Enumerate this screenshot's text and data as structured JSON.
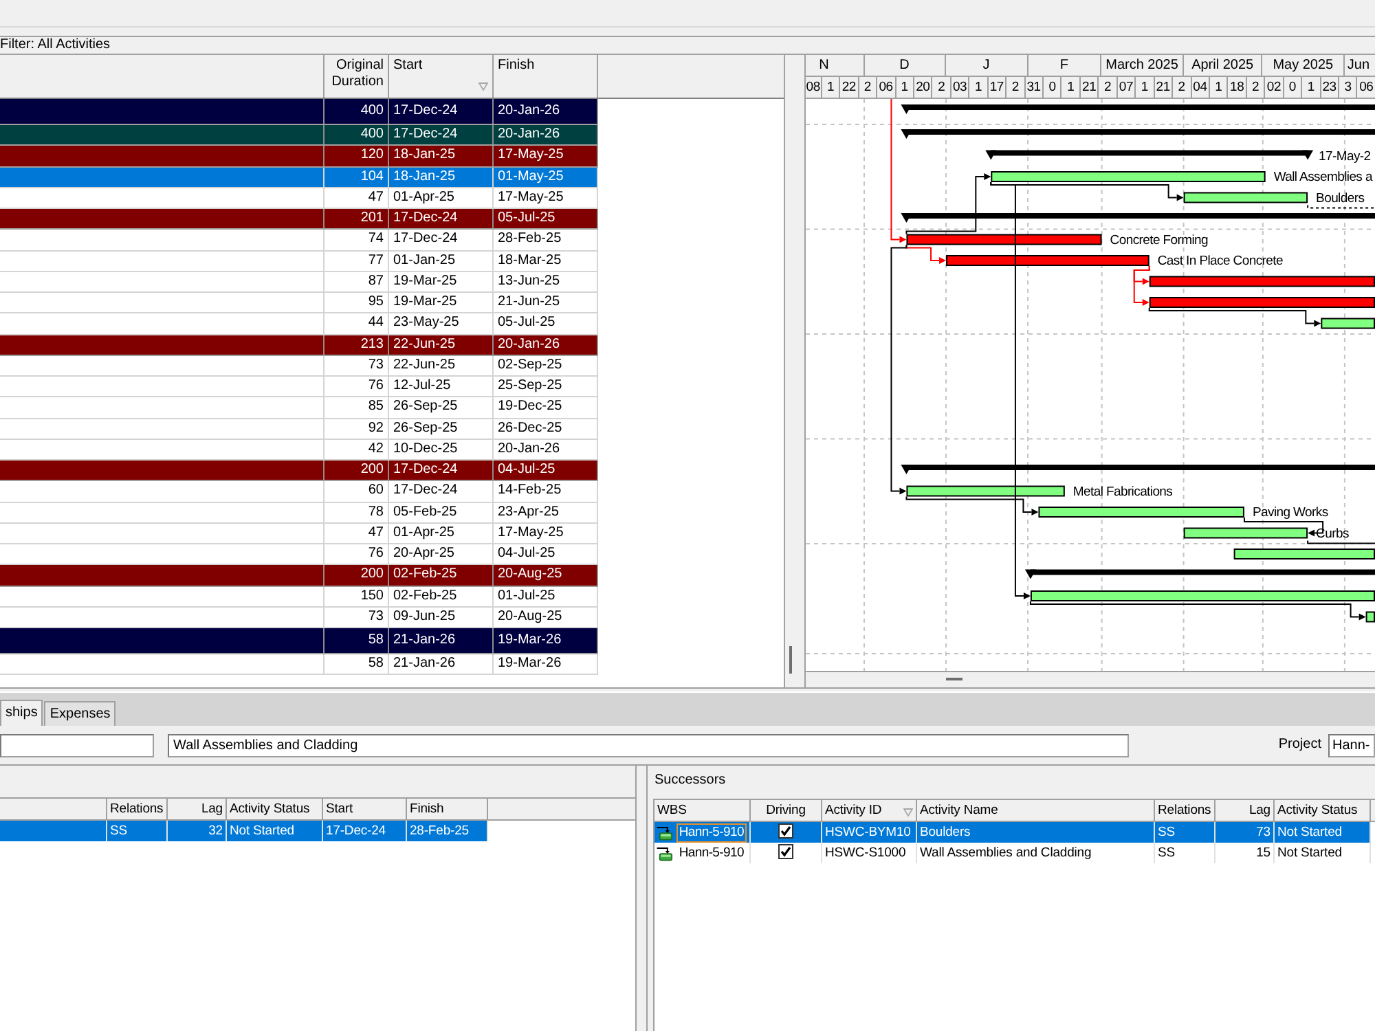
{
  "filter": {
    "label": "Filter: All Activities"
  },
  "table": {
    "columns": [
      {
        "label": "Original Duration",
        "sorted": false
      },
      {
        "label": "Start",
        "sorted": true
      },
      {
        "label": "Finish",
        "sorted": false
      }
    ],
    "rows": [
      {
        "kind": "project",
        "color": "#000040",
        "duration": "400",
        "start": "17-Dec-24",
        "finish": "20-Jan-26",
        "selected": false
      },
      {
        "kind": "wbs",
        "color": "#004040",
        "duration": "400",
        "start": "17-Dec-24",
        "finish": "20-Jan-26",
        "selected": false
      },
      {
        "kind": "wbs",
        "color": "#800000",
        "duration": "120",
        "start": "18-Jan-25",
        "finish": "17-May-25",
        "selected": false,
        "bar_label": "17-May-2"
      },
      {
        "kind": "activity",
        "duration": "104",
        "start": "18-Jan-25",
        "finish": "01-May-25",
        "selected": true,
        "critical": false,
        "bar_label": "Wall Assemblies a"
      },
      {
        "kind": "activity",
        "duration": "47",
        "start": "01-Apr-25",
        "finish": "17-May-25",
        "selected": false,
        "critical": false,
        "bar_label": "Boulders"
      },
      {
        "kind": "wbs",
        "color": "#800000",
        "duration": "201",
        "start": "17-Dec-24",
        "finish": "05-Jul-25",
        "selected": false
      },
      {
        "kind": "activity",
        "duration": "74",
        "start": "17-Dec-24",
        "finish": "28-Feb-25",
        "selected": false,
        "critical": true,
        "bar_label": "Concrete Forming"
      },
      {
        "kind": "activity",
        "duration": "77",
        "start": "01-Jan-25",
        "finish": "18-Mar-25",
        "selected": false,
        "critical": true,
        "bar_label": "Cast In Place Concrete"
      },
      {
        "kind": "activity",
        "duration": "87",
        "start": "19-Mar-25",
        "finish": "13-Jun-25",
        "selected": false,
        "critical": true
      },
      {
        "kind": "activity",
        "duration": "95",
        "start": "19-Mar-25",
        "finish": "21-Jun-25",
        "selected": false,
        "critical": true
      },
      {
        "kind": "activity",
        "duration": "44",
        "start": "23-May-25",
        "finish": "05-Jul-25",
        "selected": false,
        "critical": false
      },
      {
        "kind": "wbs",
        "color": "#800000",
        "duration": "213",
        "start": "22-Jun-25",
        "finish": "20-Jan-26",
        "selected": false
      },
      {
        "kind": "activity",
        "duration": "73",
        "start": "22-Jun-25",
        "finish": "02-Sep-25",
        "selected": false
      },
      {
        "kind": "activity",
        "duration": "76",
        "start": "12-Jul-25",
        "finish": "25-Sep-25",
        "selected": false
      },
      {
        "kind": "activity",
        "duration": "85",
        "start": "26-Sep-25",
        "finish": "19-Dec-25",
        "selected": false
      },
      {
        "kind": "activity",
        "duration": "92",
        "start": "26-Sep-25",
        "finish": "26-Dec-25",
        "selected": false
      },
      {
        "kind": "activity",
        "duration": "42",
        "start": "10-Dec-25",
        "finish": "20-Jan-26",
        "selected": false
      },
      {
        "kind": "wbs",
        "color": "#800000",
        "duration": "200",
        "start": "17-Dec-24",
        "finish": "04-Jul-25",
        "selected": false
      },
      {
        "kind": "activity",
        "duration": "60",
        "start": "17-Dec-24",
        "finish": "14-Feb-25",
        "selected": false,
        "critical": false,
        "bar_label": "Metal Fabrications"
      },
      {
        "kind": "activity",
        "duration": "78",
        "start": "05-Feb-25",
        "finish": "23-Apr-25",
        "selected": false,
        "critical": false,
        "bar_label": "Paving Works"
      },
      {
        "kind": "activity",
        "duration": "47",
        "start": "01-Apr-25",
        "finish": "17-May-25",
        "selected": false,
        "critical": false,
        "bar_label": "Curbs"
      },
      {
        "kind": "activity",
        "duration": "76",
        "start": "20-Apr-25",
        "finish": "04-Jul-25",
        "selected": false,
        "critical": false
      },
      {
        "kind": "wbs",
        "color": "#800000",
        "duration": "200",
        "start": "02-Feb-25",
        "finish": "20-Aug-25",
        "selected": false
      },
      {
        "kind": "activity",
        "duration": "150",
        "start": "02-Feb-25",
        "finish": "01-Jul-25",
        "selected": false,
        "critical": false
      },
      {
        "kind": "activity",
        "duration": "73",
        "start": "09-Jun-25",
        "finish": "20-Aug-25",
        "selected": false,
        "critical": false
      },
      {
        "kind": "project",
        "color": "#000040",
        "duration": "58",
        "start": "21-Jan-26",
        "finish": "19-Mar-26",
        "selected": false
      },
      {
        "kind": "activity",
        "duration": "58",
        "start": "21-Jan-26",
        "finish": "19-Mar-26",
        "selected": false
      }
    ]
  },
  "gantt": {
    "months": [
      "N",
      "D",
      "J",
      "F",
      "March 2025",
      "April 2025",
      "May 2025",
      "Jun"
    ],
    "weeks": [
      "08",
      "1",
      "22",
      "2",
      "06",
      "1",
      "20",
      "2",
      "03",
      "1",
      "17",
      "2",
      "31",
      "0",
      "1",
      "21",
      "2",
      "07",
      "1",
      "21",
      "2",
      "04",
      "1",
      "18",
      "2",
      "02",
      "0",
      "1",
      "23",
      "3",
      "06"
    ]
  },
  "details": {
    "tabs": [
      {
        "label": "ships",
        "selected": true
      },
      {
        "label": "Expenses",
        "selected": false
      }
    ],
    "name_field": {
      "value": "Wall Assemblies and Cladding"
    },
    "project_field": {
      "label": "Project",
      "value": "Hann-"
    }
  },
  "predecessors": {
    "columns": [
      {
        "label": "Relations"
      },
      {
        "label": "Lag"
      },
      {
        "label": "Activity Status"
      },
      {
        "label": "Start"
      },
      {
        "label": "Finish"
      }
    ],
    "rows": [
      {
        "selected": true,
        "relationship": "SS",
        "lag": "32",
        "status": "Not Started",
        "start": "17-Dec-24",
        "finish": "28-Feb-25"
      }
    ]
  },
  "successors": {
    "title": "Successors",
    "columns": [
      {
        "label": "WBS",
        "sorted": false
      },
      {
        "label": "Driving",
        "sorted": false
      },
      {
        "label": "Activity ID",
        "sorted": true
      },
      {
        "label": "Activity Name",
        "sorted": false
      },
      {
        "label": "Relations",
        "sorted": false
      },
      {
        "label": "Lag",
        "sorted": false
      },
      {
        "label": "Activity Status",
        "sorted": false
      }
    ],
    "rows": [
      {
        "selected": true,
        "focused": true,
        "wbs": "Hann-5-910",
        "driving": true,
        "activity_id": "HSWC-BYM10",
        "activity_name": "Boulders",
        "relationship": "SS",
        "lag": "73",
        "status": "Not Started"
      },
      {
        "selected": false,
        "focused": false,
        "wbs": "Hann-5-910",
        "driving": true,
        "activity_id": "HSWC-S1000",
        "activity_name": "Wall Assemblies and Cladding",
        "relationship": "SS",
        "lag": "15",
        "status": "Not Started"
      }
    ]
  }
}
